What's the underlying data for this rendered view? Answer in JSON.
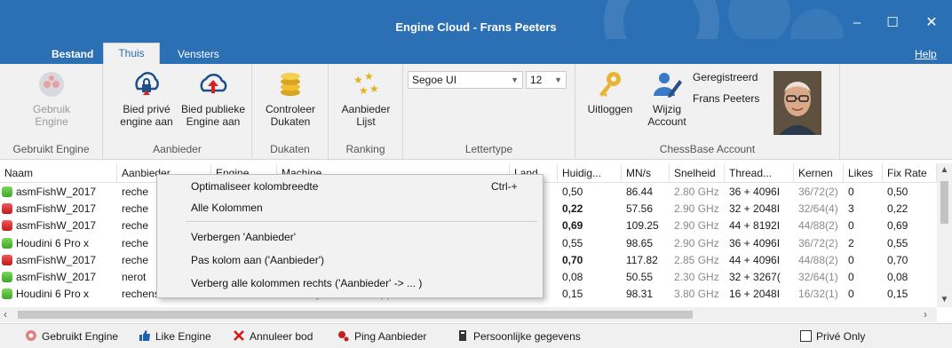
{
  "window": {
    "title": "Engine Cloud - Frans Peeters",
    "controls": {
      "minimize": "–",
      "maximize": "☐",
      "close": "✕"
    }
  },
  "tabs": {
    "file": "Bestand",
    "home": "Thuis",
    "windows": "Vensters",
    "help": "Help"
  },
  "ribbon": {
    "groups": {
      "used": {
        "label": "Gebruikt Engine",
        "button_line1": "Gebruik",
        "button_line2": "Engine"
      },
      "offer": {
        "label": "Aanbieder",
        "private_line1": "Bied privé",
        "private_line2": "engine aan",
        "public_line1": "Bied publieke",
        "public_line2": "Engine aan"
      },
      "ducats": {
        "label": "Dukaten",
        "check_line1": "Controleer",
        "check_line2": "Dukaten"
      },
      "ranking": {
        "label": "Ranking",
        "list_line1": "Aanbieder",
        "list_line2": "Lijst"
      },
      "font": {
        "label": "Lettertype",
        "font_name": "Segoe UI",
        "font_size": "12"
      },
      "account": {
        "label": "ChessBase Account",
        "logout": "Uitloggen",
        "change_line1": "Wijzig",
        "change_line2": "Account",
        "registered": "Geregistreerd",
        "user": "Frans Peeters"
      }
    }
  },
  "grid": {
    "columns": [
      "Naam",
      "Aanbieder",
      "Engine",
      "Machine",
      "Land",
      "Huidig...",
      "MN/s",
      "Snelheid",
      "Thread...",
      "Kernen",
      "Likes",
      "Fix Rate"
    ],
    "rows": [
      {
        "status": "green",
        "name": "asmFishW_2017",
        "provider": "reche",
        "machine": "",
        "current": "0,50",
        "mns": "86.44",
        "speed": "2.80 GHz",
        "threads": "36 + 4096I",
        "cores": "36/72(2)",
        "likes": "0",
        "fixrate": "0,50",
        "bold": false
      },
      {
        "status": "red",
        "name": "asmFishW_2017",
        "provider": "reche",
        "machine": "",
        "current": "0,22",
        "mns": "57.56",
        "speed": "2.90 GHz",
        "threads": "32 + 2048I",
        "cores": "32/64(4)",
        "likes": "3",
        "fixrate": "0,22",
        "bold": true
      },
      {
        "status": "red",
        "name": "asmFishW_2017",
        "provider": "reche",
        "machine": "",
        "current": "0,69",
        "mns": "109.25",
        "speed": "2.90 GHz",
        "threads": "44 + 8192I",
        "cores": "44/88(2)",
        "likes": "0",
        "fixrate": "0,69",
        "bold": true
      },
      {
        "status": "green",
        "name": "Houdini 6 Pro x",
        "provider": "reche",
        "machine": "",
        "current": "0,55",
        "mns": "98.65",
        "speed": "2.90 GHz",
        "threads": "36 + 4096I",
        "cores": "36/72(2)",
        "likes": "2",
        "fixrate": "0,55",
        "bold": false
      },
      {
        "status": "red",
        "name": "asmFishW_2017",
        "provider": "reche",
        "machine": "",
        "current": "0,70",
        "mns": "117.82",
        "speed": "2.85 GHz",
        "threads": "44 + 4096I",
        "cores": "44/88(2)",
        "likes": "0",
        "fixrate": "0,70",
        "bold": true
      },
      {
        "status": "green",
        "name": "asmFishW_2017",
        "provider": "nerot",
        "machine": "",
        "current": "0,08",
        "mns": "50.55",
        "speed": "2.30 GHz",
        "threads": "32 + 3267(",
        "cores": "32/64(1)",
        "likes": "0",
        "fixrate": "0,08",
        "bold": false
      },
      {
        "status": "green",
        "name": "Houdini 6 Pro x",
        "provider": "rechenschieber",
        "machine": "AMD Ryzen Threadripper 1950X 16-Core",
        "current": "0,15",
        "mns": "98.31",
        "speed": "3.80 GHz",
        "threads": "16 + 2048I",
        "cores": "16/32(1)",
        "likes": "0",
        "fixrate": "0,15",
        "bold": false
      }
    ]
  },
  "context_menu": {
    "items": [
      {
        "label": "Optimaliseer kolombreedte",
        "shortcut": "Ctrl-+"
      },
      {
        "label": "Alle Kolommen",
        "shortcut": ""
      },
      {
        "label": "Verbergen 'Aanbieder'",
        "shortcut": ""
      },
      {
        "label": "Pas kolom aan ('Aanbieder')",
        "shortcut": ""
      },
      {
        "label": "Verberg alle kolommen rechts ('Aanbieder' -> ... )",
        "shortcut": ""
      }
    ]
  },
  "statusbar": {
    "use_engine": "Gebruikt Engine",
    "like_engine": "Like Engine",
    "cancel_bid": "Annuleer bod",
    "ping": "Ping Aanbieder",
    "personal": "Persoonlijke gegevens",
    "private_only": "Privé Only"
  },
  "colors": {
    "titlebar": "#2b6fb5",
    "ribbon_bg": "#f1f1f1",
    "status_green": "#3fa62a",
    "status_red": "#c01818"
  }
}
